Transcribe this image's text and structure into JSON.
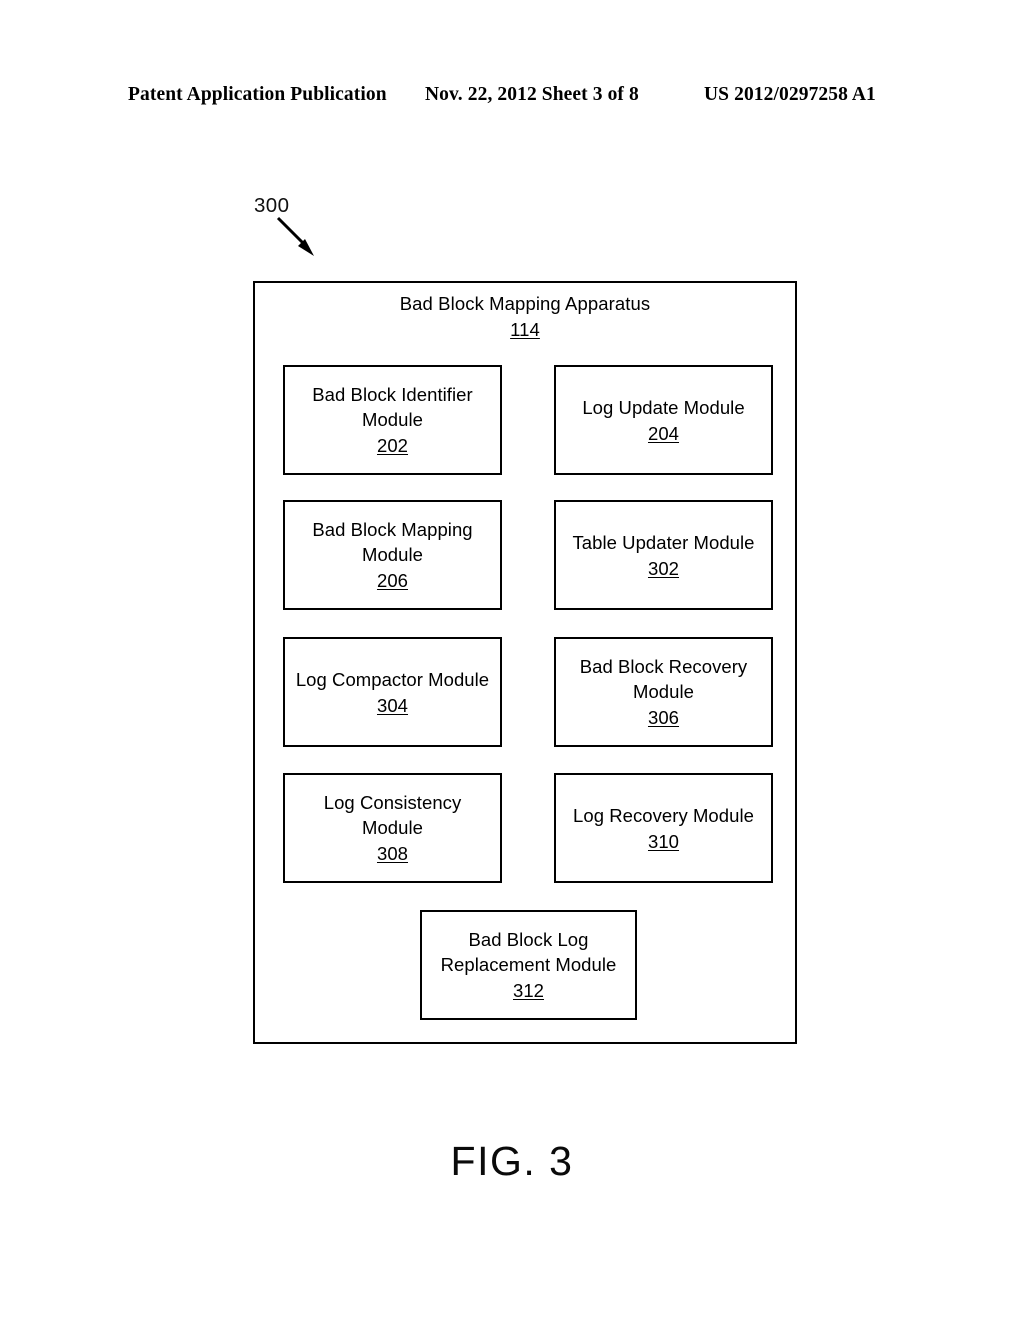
{
  "header": {
    "publication": "Patent Application Publication",
    "date_sheet": "Nov. 22, 2012  Sheet 3 of 8",
    "patent_number": "US 2012/0297258 A1"
  },
  "figure": {
    "reference_numeral": "300",
    "caption": "FIG. 3"
  },
  "apparatus": {
    "title": "Bad Block Mapping Apparatus",
    "ref": "114"
  },
  "modules": [
    {
      "label": "Bad Block Identifier\nModule",
      "ref": "202",
      "column": "left",
      "row": 1
    },
    {
      "label": "Log Update Module",
      "ref": "204",
      "column": "right",
      "row": 1
    },
    {
      "label": "Bad Block Mapping\nModule",
      "ref": "206",
      "column": "left",
      "row": 2
    },
    {
      "label": "Table Updater Module",
      "ref": "302",
      "column": "right",
      "row": 2
    },
    {
      "label": "Log Compactor Module",
      "ref": "304",
      "column": "left",
      "row": 3
    },
    {
      "label": "Bad Block Recovery\nModule",
      "ref": "306",
      "column": "right",
      "row": 3
    },
    {
      "label": "Log Consistency Module",
      "ref": "308",
      "column": "left",
      "row": 4
    },
    {
      "label": "Log Recovery Module",
      "ref": "310",
      "column": "right",
      "row": 4
    },
    {
      "label": "Bad Block Log\nReplacement Module",
      "ref": "312",
      "column": "center",
      "row": 5
    }
  ],
  "colors": {
    "ink": "#000000",
    "paper": "#ffffff"
  }
}
